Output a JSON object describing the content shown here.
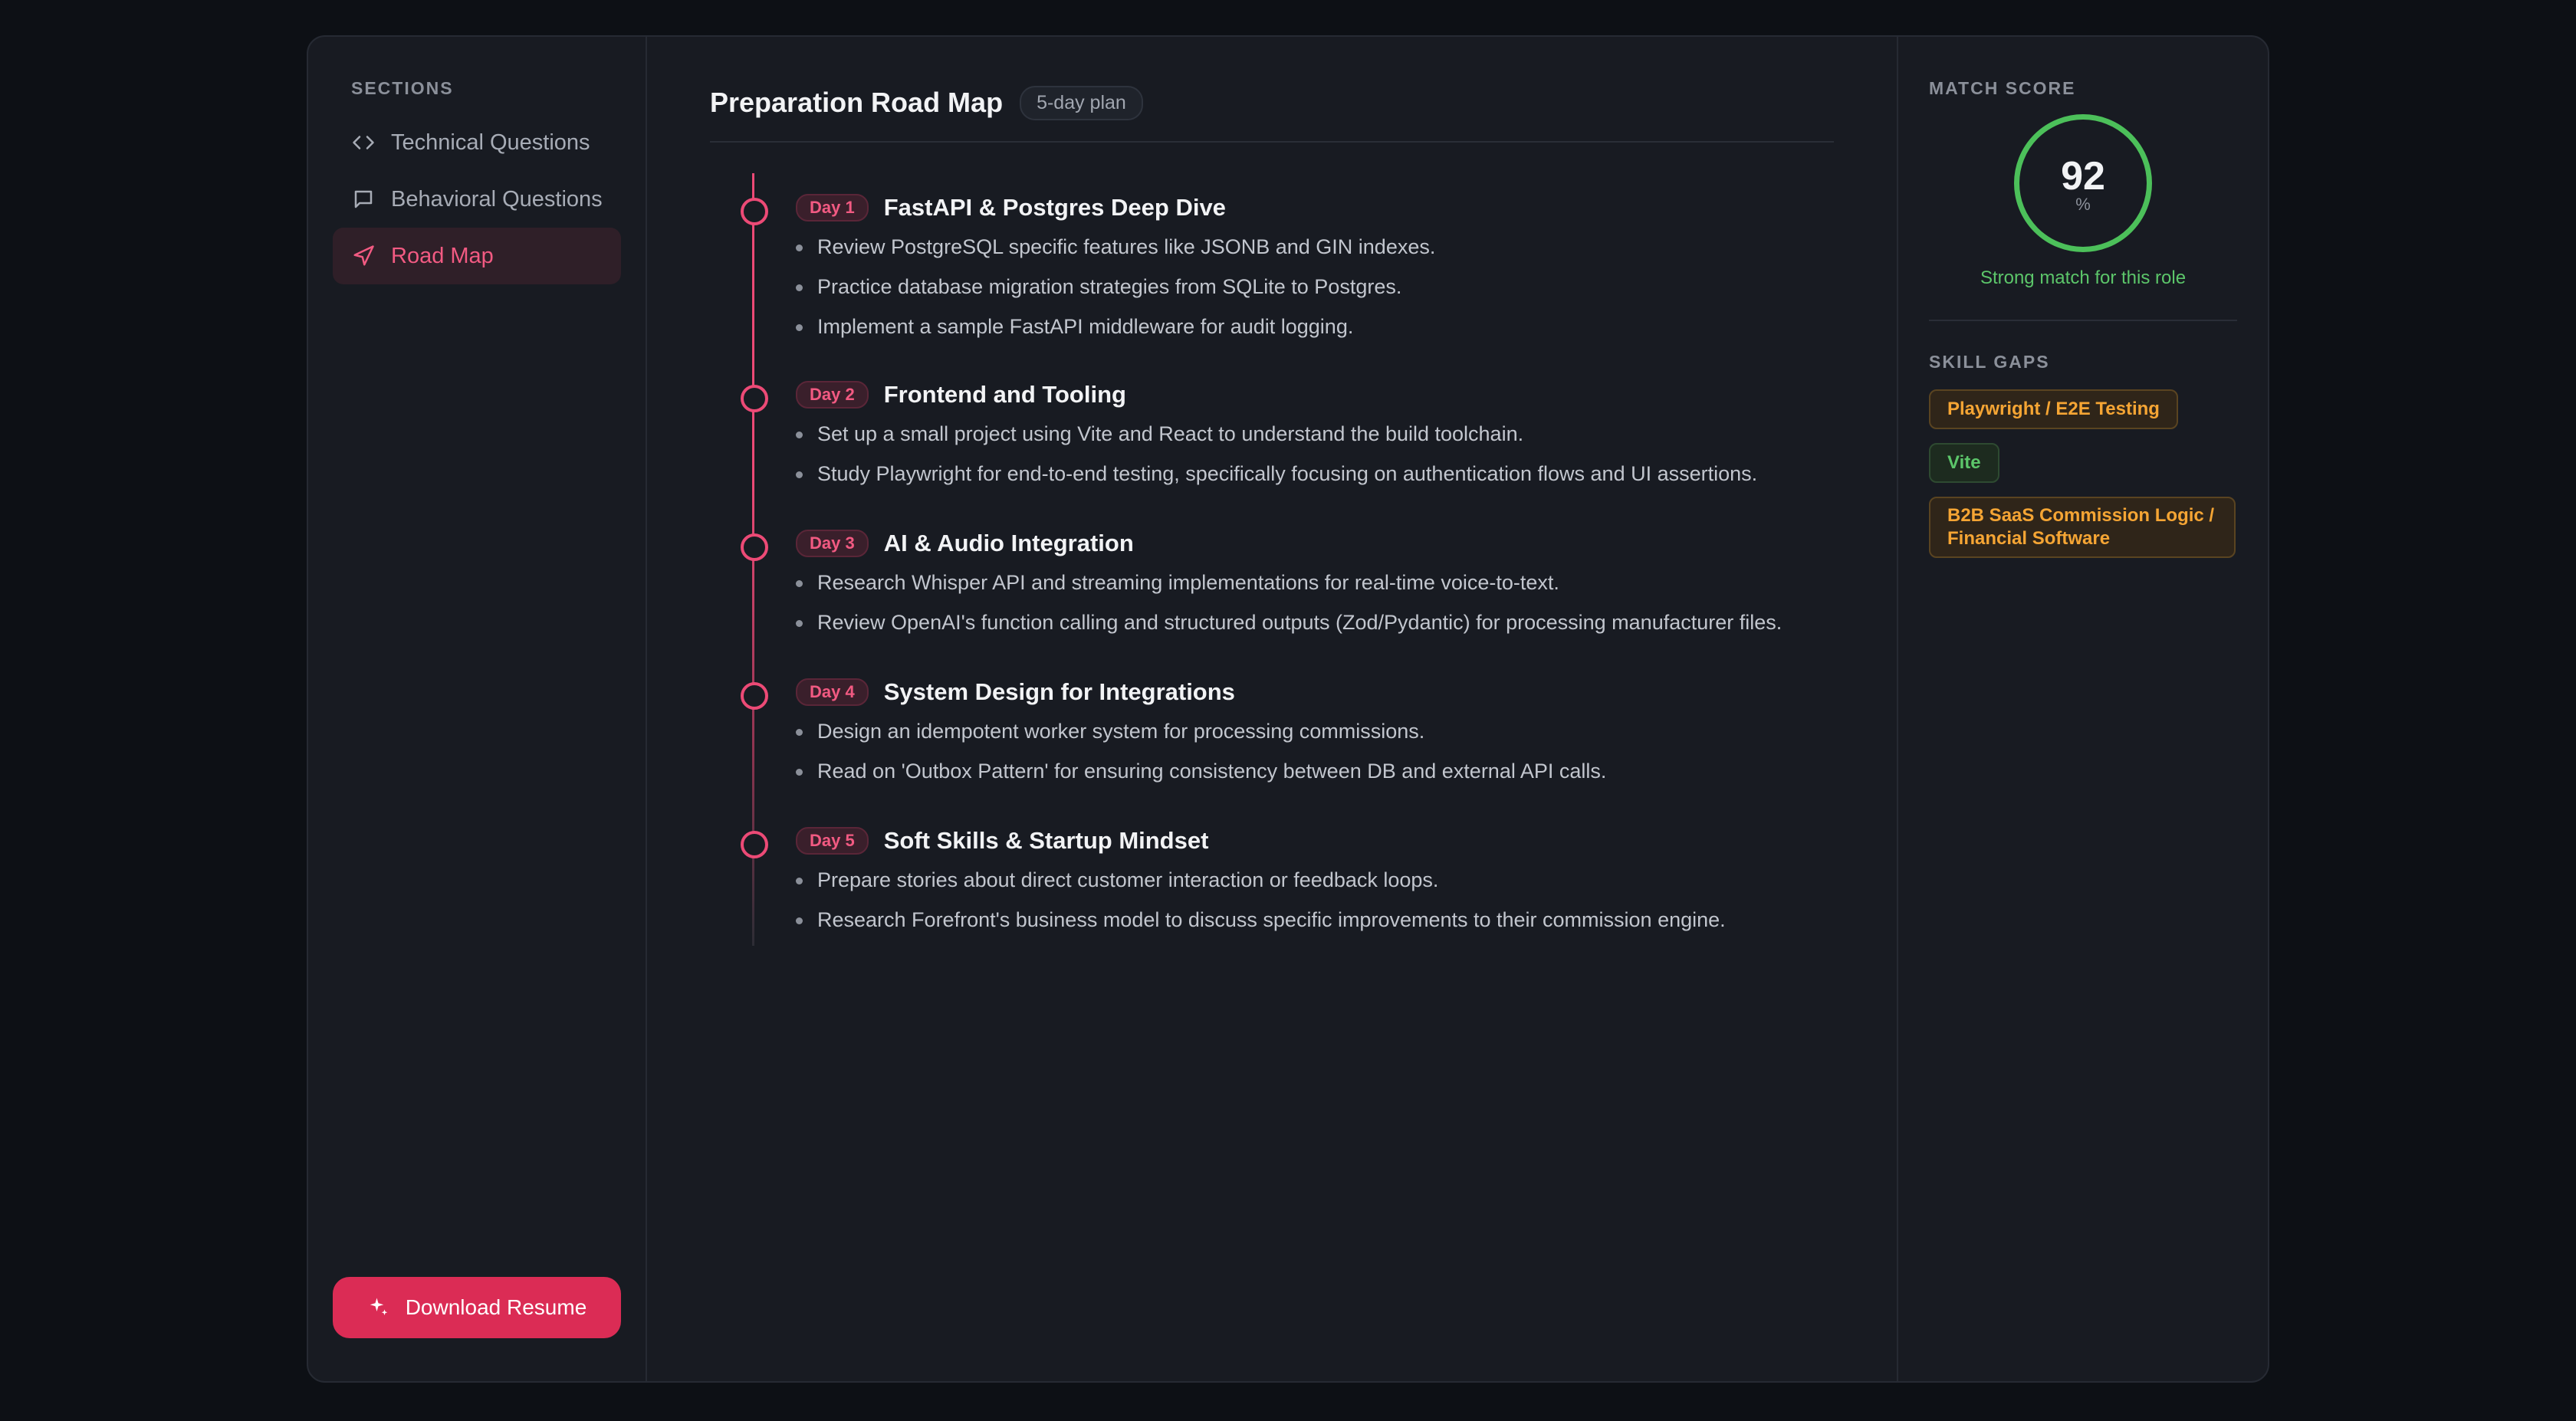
{
  "sidebar": {
    "heading": "SECTIONS",
    "items": [
      {
        "label": "Technical Questions",
        "icon": "code-icon",
        "active": false
      },
      {
        "label": "Behavioral Questions",
        "icon": "message-icon",
        "active": false
      },
      {
        "label": "Road Map",
        "icon": "navigation-icon",
        "active": true
      }
    ],
    "download_label": "Download Resume"
  },
  "main": {
    "title": "Preparation Road Map",
    "badge": "5-day plan",
    "days": [
      {
        "badge": "Day 1",
        "title": "FastAPI & Postgres Deep Dive",
        "items": [
          "Review PostgreSQL specific features like JSONB and GIN indexes.",
          "Practice database migration strategies from SQLite to Postgres.",
          "Implement a sample FastAPI middleware for audit logging."
        ]
      },
      {
        "badge": "Day 2",
        "title": "Frontend and Tooling",
        "items": [
          "Set up a small project using Vite and React to understand the build toolchain.",
          "Study Playwright for end-to-end testing, specifically focusing on authentication flows and UI assertions."
        ]
      },
      {
        "badge": "Day 3",
        "title": "AI & Audio Integration",
        "items": [
          "Research Whisper API and streaming implementations for real-time voice-to-text.",
          "Review OpenAI's function calling and structured outputs (Zod/Pydantic) for processing manufacturer files."
        ]
      },
      {
        "badge": "Day 4",
        "title": "System Design for Integrations",
        "items": [
          "Design an idempotent worker system for processing commissions.",
          "Read on 'Outbox Pattern' for ensuring consistency between DB and external API calls."
        ]
      },
      {
        "badge": "Day 5",
        "title": "Soft Skills & Startup Mindset",
        "items": [
          "Prepare stories about direct customer interaction or feedback loops.",
          "Research Forefront's business model to discuss specific improvements to their commission engine."
        ]
      }
    ]
  },
  "right": {
    "match_heading": "MATCH SCORE",
    "score": "92",
    "score_unit": "%",
    "score_caption": "Strong match for this role",
    "gaps_heading": "SKILL GAPS",
    "gaps": [
      {
        "label": "Playwright / E2E Testing",
        "tone": "warn"
      },
      {
        "label": "Vite",
        "tone": "ok"
      },
      {
        "label": "B2B SaaS Commission Logic / Financial Software",
        "tone": "warn"
      }
    ]
  },
  "colors": {
    "accent": "#ec4a76",
    "button": "#db2c55",
    "success": "#4cc05a",
    "warning": "#f5a534",
    "background": "#181b22"
  }
}
